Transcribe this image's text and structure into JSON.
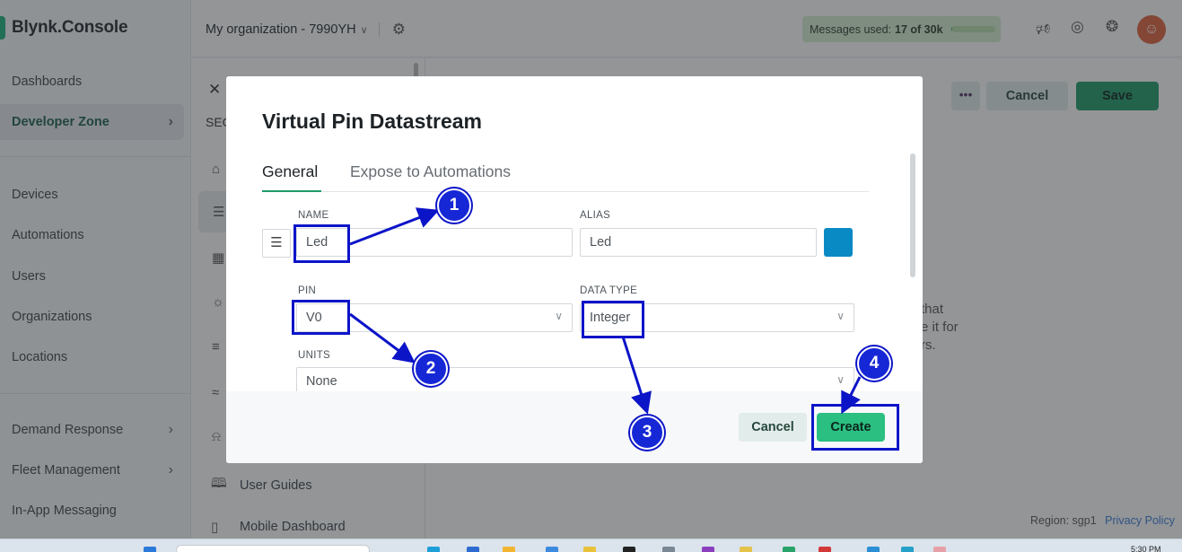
{
  "app": {
    "logo_text": "Blynk.Console",
    "org_name": "My organization - 7990YH",
    "messages": {
      "label": "Messages used:",
      "count": "17 of 30k",
      "used_fraction": 0.0006
    },
    "region_label": "Region: sgp1",
    "privacy_link": "Privacy Policy"
  },
  "sidebar": {
    "items": [
      {
        "label": "Dashboards"
      },
      {
        "label": "Developer Zone",
        "active": true
      },
      {
        "label": "Devices"
      },
      {
        "label": "Automations"
      },
      {
        "label": "Users"
      },
      {
        "label": "Organizations"
      },
      {
        "label": "Locations"
      },
      {
        "label": "Demand Response"
      },
      {
        "label": "Fleet Management"
      },
      {
        "label": "In-App Messaging"
      }
    ]
  },
  "panel": {
    "section_label": "SEC",
    "bottom_links": [
      "User Guides",
      "Mobile Dashboard"
    ]
  },
  "main": {
    "cancel_label": "Cancel",
    "save_label": "Save",
    "help_lines": [
      "that",
      "e it for",
      "rs."
    ]
  },
  "modal": {
    "title": "Virtual Pin Datastream",
    "tabs": [
      "General",
      "Expose to Automations"
    ],
    "name": {
      "label": "NAME",
      "value": "Led"
    },
    "alias": {
      "label": "ALIAS",
      "value": "Led"
    },
    "pin": {
      "label": "PIN",
      "value": "V0"
    },
    "data_type": {
      "label": "DATA TYPE",
      "value": "Integer"
    },
    "units": {
      "label": "UNITS",
      "value": "None"
    },
    "cancel_label": "Cancel",
    "create_label": "Create"
  },
  "annotations": [
    "1",
    "2",
    "3",
    "4"
  ],
  "colors": {
    "accent_green": "#1f9b68",
    "create_green": "#2bbf82",
    "annotation_blue": "#0c14c8",
    "swatch_blue": "#0a8ac4"
  },
  "taskbar": {
    "clock": "5:30 PM"
  }
}
